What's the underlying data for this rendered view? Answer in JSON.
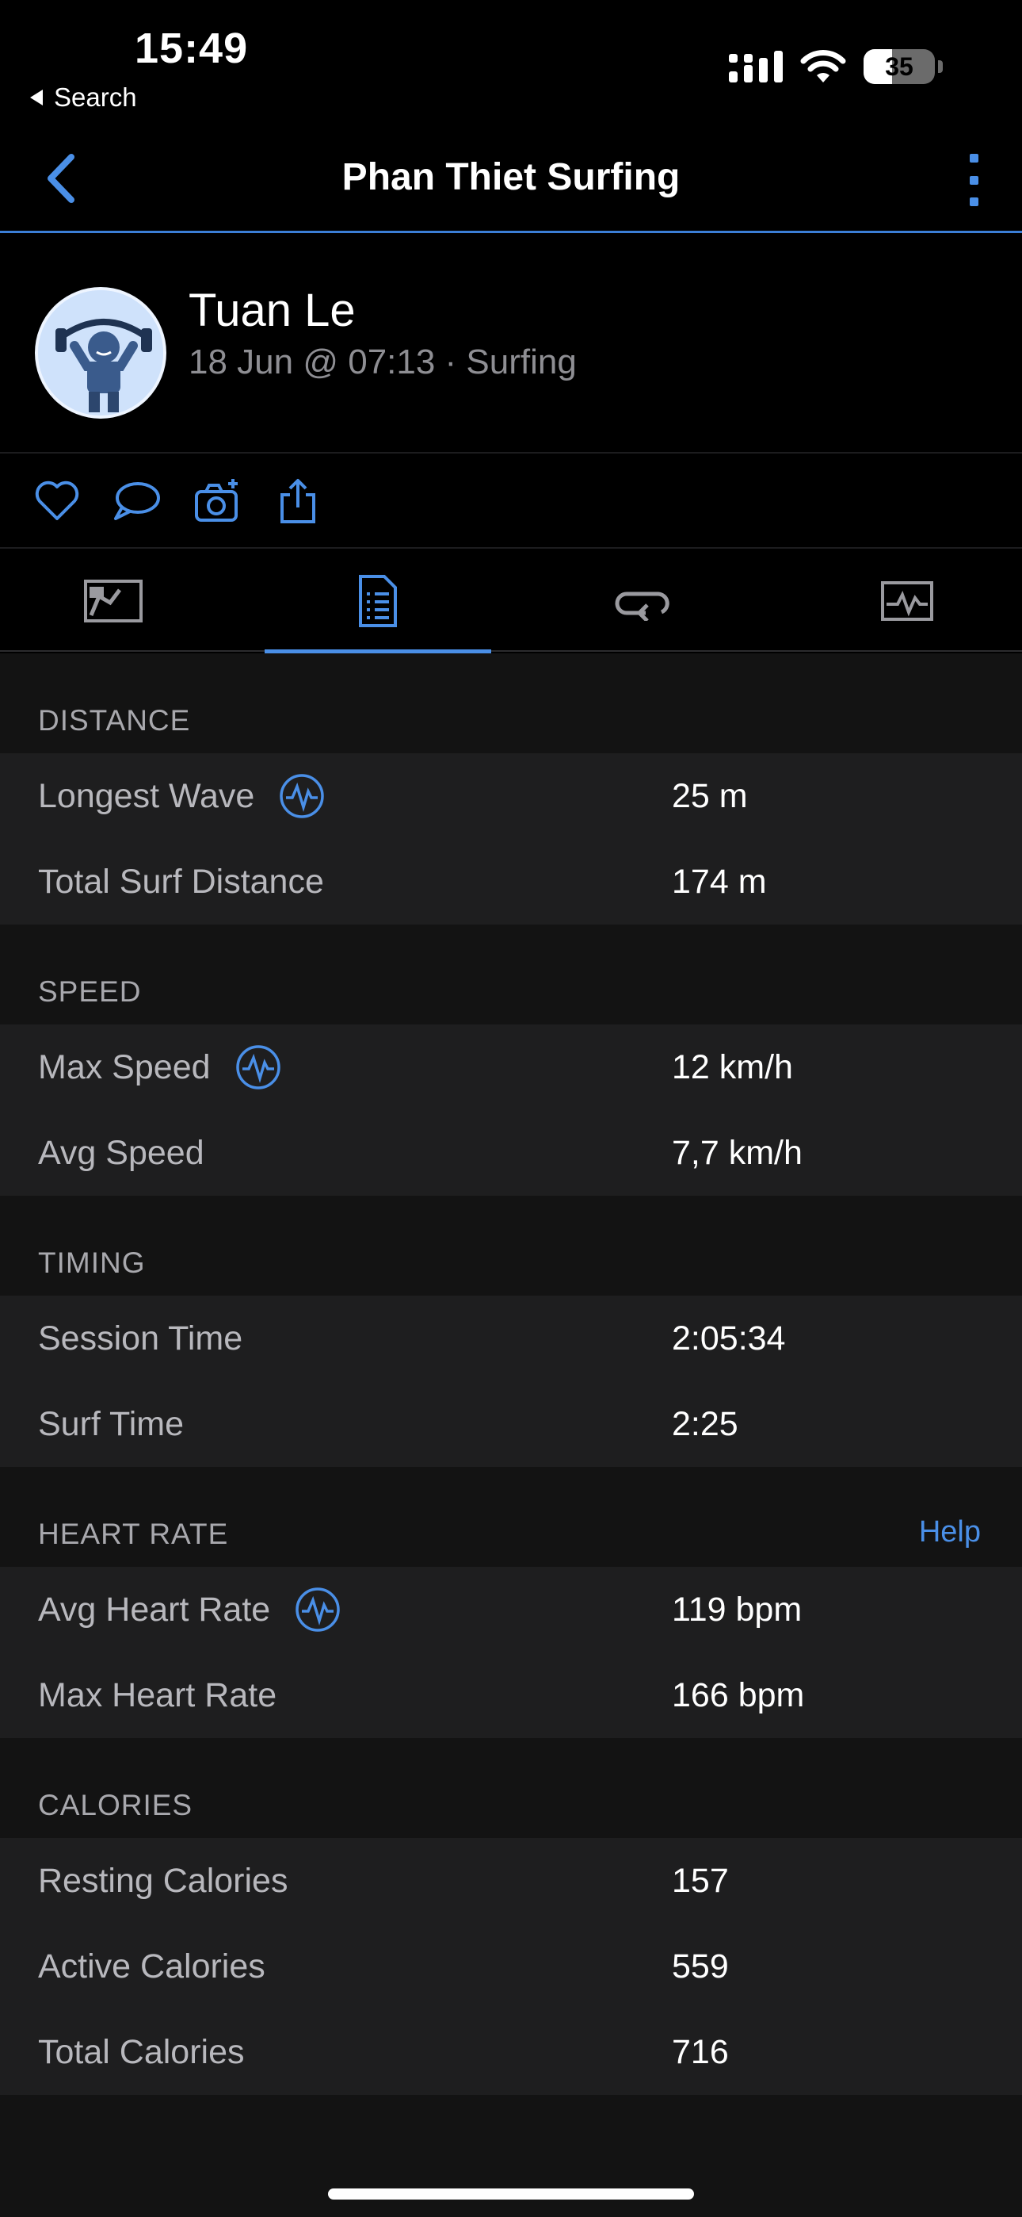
{
  "status_bar": {
    "time": "15:49",
    "back_label": "Search",
    "battery": "35"
  },
  "nav": {
    "title": "Phan Thiet Surfing"
  },
  "profile": {
    "name": "Tuan Le",
    "meta": "18 Jun @ 07:13 · Surfing"
  },
  "tabs": [
    "map-tab",
    "stats-tab",
    "laps-tab",
    "charts-tab"
  ],
  "sections": {
    "distance": {
      "header": "DISTANCE",
      "rows": [
        {
          "label": "Longest Wave",
          "value": "25 m"
        },
        {
          "label": "Total Surf Distance",
          "value": "174 m"
        }
      ]
    },
    "speed": {
      "header": "SPEED",
      "rows": [
        {
          "label": "Max Speed",
          "value": "12 km/h"
        },
        {
          "label": "Avg Speed",
          "value": "7,7 km/h"
        }
      ]
    },
    "timing": {
      "header": "TIMING",
      "rows": [
        {
          "label": "Session Time",
          "value": "2:05:34"
        },
        {
          "label": "Surf Time",
          "value": "2:25"
        }
      ]
    },
    "heart_rate": {
      "header": "HEART RATE",
      "help": "Help",
      "rows": [
        {
          "label": "Avg Heart Rate",
          "value": "119 bpm"
        },
        {
          "label": "Max Heart Rate",
          "value": "166 bpm"
        }
      ]
    },
    "calories": {
      "header": "CALORIES",
      "rows": [
        {
          "label": "Resting Calories",
          "value": "157"
        },
        {
          "label": "Active Calories",
          "value": "559"
        },
        {
          "label": "Total Calories",
          "value": "716"
        }
      ]
    }
  },
  "colors": {
    "accent": "#4a8fe7",
    "background": "#000000",
    "row_bg": "#1e1e1f"
  }
}
